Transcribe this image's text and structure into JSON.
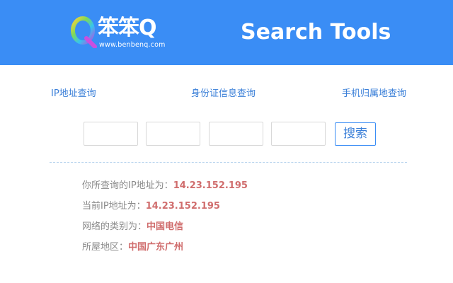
{
  "header": {
    "logo_text": "笨笨Q",
    "logo_url": "www.benbenq.com",
    "title": "Search Tools",
    "background_color": "#3a8df5"
  },
  "nav": {
    "ip_lookup": "IP地址查询",
    "id_lookup": "身份证信息查询",
    "phone_lookup": "手机归属地查询"
  },
  "search": {
    "ip_octet_1": "",
    "ip_octet_2": "",
    "ip_octet_3": "",
    "ip_octet_4": "",
    "button_label": "搜索"
  },
  "results": [
    {
      "label": "你所查询的IP地址为：",
      "value": "14.23.152.195"
    },
    {
      "label": "当前IP地址为：",
      "value": "14.23.152.195"
    },
    {
      "label": "网络的类别为：",
      "value": "中国电信"
    },
    {
      "label": "所屋地区：",
      "value": "中国广东广州"
    }
  ],
  "colors": {
    "accent": "#3a8df5",
    "link": "#3a7fd8",
    "result_value": "#d06d6d",
    "result_label": "#8a8a8a"
  }
}
